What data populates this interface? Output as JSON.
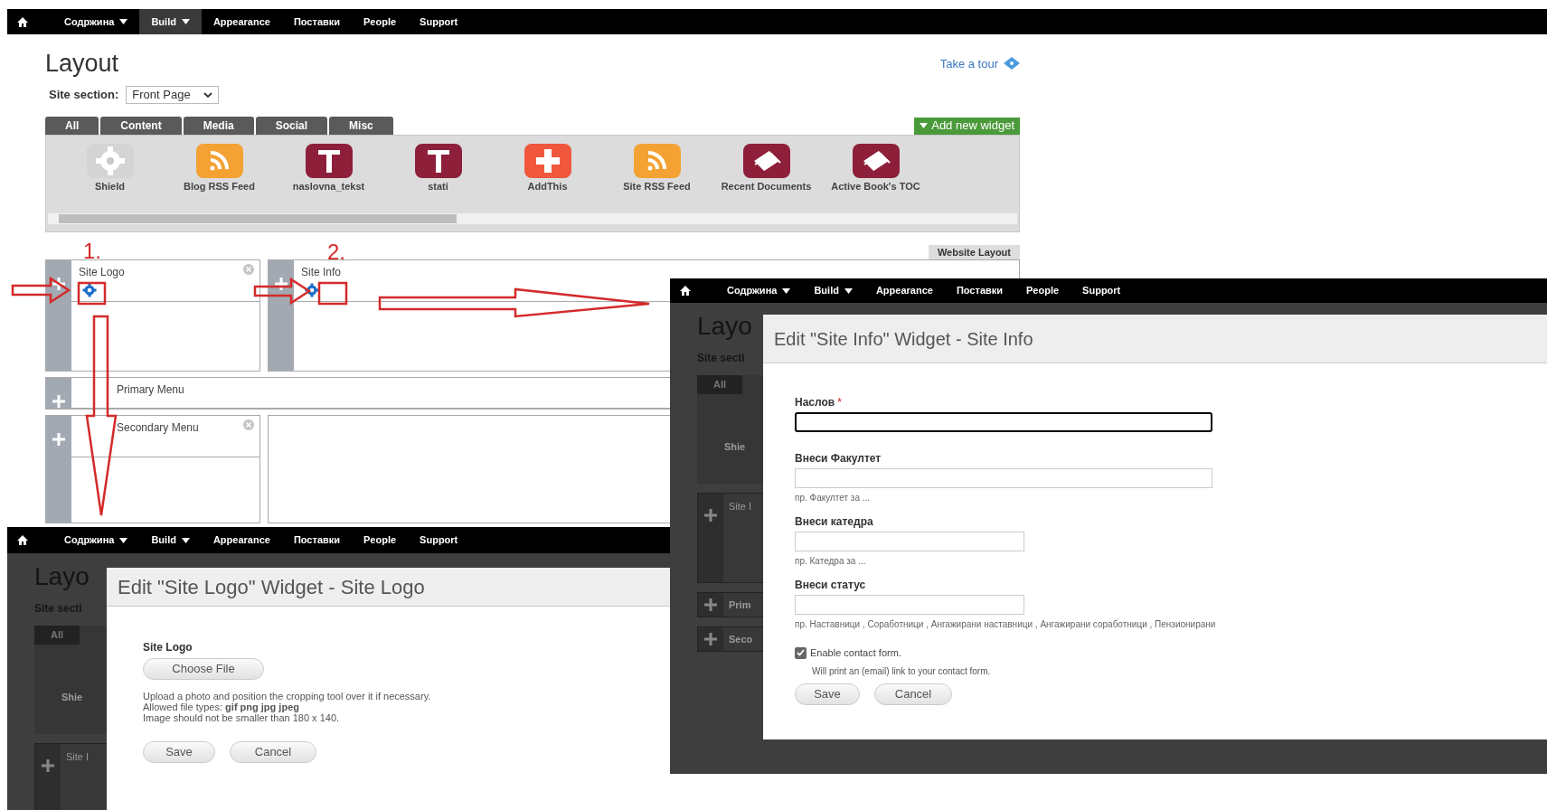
{
  "nav": {
    "items": [
      {
        "label": "Содржина",
        "dropdown": true,
        "selected": false
      },
      {
        "label": "Build",
        "dropdown": true,
        "selected": true
      },
      {
        "label": "Appearance",
        "dropdown": false,
        "selected": false
      },
      {
        "label": "Поставки",
        "dropdown": false,
        "selected": false
      },
      {
        "label": "People",
        "dropdown": false,
        "selected": false
      },
      {
        "label": "Support",
        "dropdown": false,
        "selected": false
      }
    ]
  },
  "page": {
    "title": "Layout",
    "tour_link": "Take a tour",
    "site_section": {
      "label": "Site section:",
      "value": "Front Page"
    },
    "widget_tabs": [
      "All",
      "Content",
      "Media",
      "Social",
      "Misc"
    ],
    "add_widget": "Add new widget",
    "widgets": [
      {
        "label": "Shield",
        "kind": "gear"
      },
      {
        "label": "Blog RSS Feed",
        "kind": "rss"
      },
      {
        "label": "naslovna_tekst",
        "kind": "text"
      },
      {
        "label": "stati",
        "kind": "text"
      },
      {
        "label": "AddThis",
        "kind": "plus"
      },
      {
        "label": "Site RSS Feed",
        "kind": "rss"
      },
      {
        "label": "Recent Documents",
        "kind": "book"
      },
      {
        "label": "Active Book's TOC",
        "kind": "book"
      }
    ],
    "layout_button": "Website Layout",
    "region_rows": [
      [
        {
          "kind": "area",
          "title": "Site Logo",
          "gear": true,
          "closable": true
        },
        {
          "kind": "area",
          "title": "Site Info",
          "gear": true,
          "closable": false
        }
      ],
      [
        {
          "kind": "area",
          "title": "Primary Menu",
          "gear": false,
          "closable": false
        }
      ],
      [
        {
          "kind": "area",
          "title": "Secondary Menu",
          "gear": false,
          "closable": true
        },
        {
          "kind": "empty"
        }
      ]
    ]
  },
  "annotations": {
    "numbers": [
      "1.",
      "2."
    ]
  },
  "site_info_dialog": {
    "nav": {
      "items": [
        {
          "label": "Содржина",
          "dropdown": true,
          "selected": false
        },
        {
          "label": "Build",
          "dropdown": true,
          "selected": false
        },
        {
          "label": "Appearance",
          "dropdown": false,
          "selected": false
        },
        {
          "label": "Поставки",
          "dropdown": false,
          "selected": false
        },
        {
          "label": "People",
          "dropdown": false,
          "selected": false
        },
        {
          "label": "Support",
          "dropdown": false,
          "selected": false
        }
      ]
    },
    "backdrop": {
      "title": "Layo",
      "site_section": "Site secti",
      "tab": "All",
      "widget": "Shie",
      "region": "Site I",
      "regions": [
        "Prim",
        "Seco"
      ]
    },
    "title": "Edit \"Site Info\" Widget - Site Info",
    "fields": [
      {
        "label": "Наслов",
        "required_mark": "*",
        "focused": true,
        "kind": "wide"
      },
      {
        "label": "Внеси Факултет",
        "focused": false,
        "kind": "wide",
        "hint": "пр. Факултет за ..."
      },
      {
        "label": "Внеси катедра",
        "focused": false,
        "kind": "narrow",
        "hint": "пр. Катедра за ..."
      },
      {
        "label": "Внеси статус",
        "focused": false,
        "kind": "narrow",
        "hint": "пр. Наставници , Соработници , Ангажирани наставници , Ангажирани соработници , Пензионирани"
      }
    ],
    "checkbox": {
      "label": "Enable contact form.",
      "checked": true,
      "description": "Will print an (email) link to your contact form."
    },
    "buttons": [
      "Save",
      "Cancel"
    ]
  },
  "site_logo_dialog": {
    "nav": {
      "items": [
        {
          "label": "Содржина",
          "dropdown": true,
          "selected": false
        },
        {
          "label": "Build",
          "dropdown": true,
          "selected": false
        },
        {
          "label": "Appearance",
          "dropdown": false,
          "selected": false
        },
        {
          "label": "Поставки",
          "dropdown": false,
          "selected": false
        },
        {
          "label": "People",
          "dropdown": false,
          "selected": false
        },
        {
          "label": "Support",
          "dropdown": false,
          "selected": false
        }
      ]
    },
    "backdrop": {
      "title": "Layo",
      "site_section": "Site secti",
      "tab": "All",
      "widget": "Shie",
      "region": "Site I"
    },
    "title": "Edit \"Site Logo\" Widget - Site Logo",
    "field_label": "Site Logo",
    "file_button": "Choose File",
    "help": [
      "Upload a photo and position the cropping tool over it if necessary.",
      "Allowed file types: **gif png jpg jpeg**",
      "Image should not be smaller than 180 x 140."
    ],
    "buttons": [
      "Save",
      "Cancel"
    ]
  }
}
